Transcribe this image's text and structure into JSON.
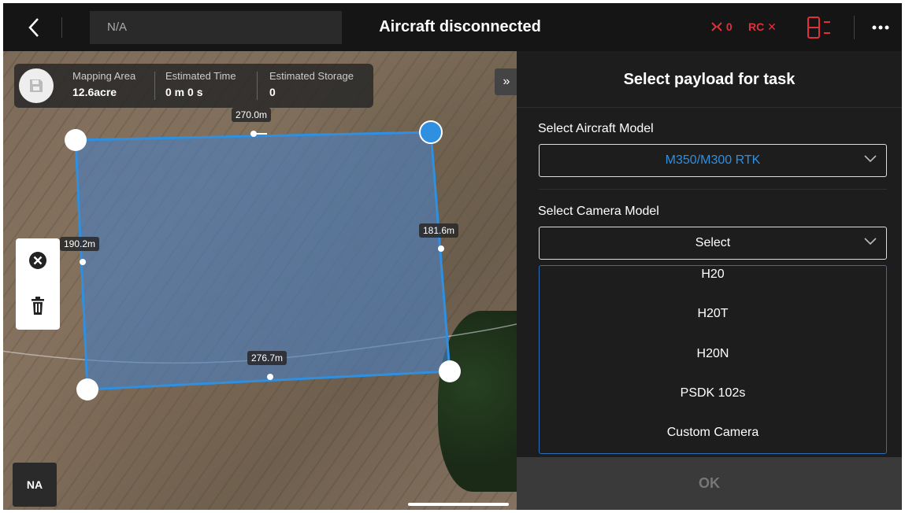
{
  "topbar": {
    "location_text": "N/A",
    "status": "Aircraft disconnected",
    "indicator_left": "0",
    "indicator_rc": "RC ✕"
  },
  "map": {
    "info": {
      "mapping_area_label": "Mapping Area",
      "mapping_area_value": "12.6acre",
      "estimated_time_label": "Estimated Time",
      "estimated_time_value": "0 m 0 s",
      "estimated_storage_label": "Estimated Storage",
      "estimated_storage_value": "0"
    },
    "expand_label": "»",
    "dimensions": {
      "top": "270.0m",
      "left": "190.2m",
      "right": "181.6m",
      "bottom": "276.7m"
    },
    "na_button": "NA"
  },
  "panel": {
    "title": "Select payload for task",
    "aircraft_label": "Select Aircraft Model",
    "aircraft_value": "M350/M300 RTK",
    "camera_label": "Select Camera Model",
    "camera_placeholder": "Select",
    "camera_options": [
      "H20",
      "H20T",
      "H20N",
      "PSDK 102s",
      "Custom Camera"
    ],
    "ok_label": "OK"
  },
  "colors": {
    "accent_blue": "#2f8fe0",
    "indicator_red": "#e0303b",
    "polygon_fill": "#4a7fc1"
  }
}
